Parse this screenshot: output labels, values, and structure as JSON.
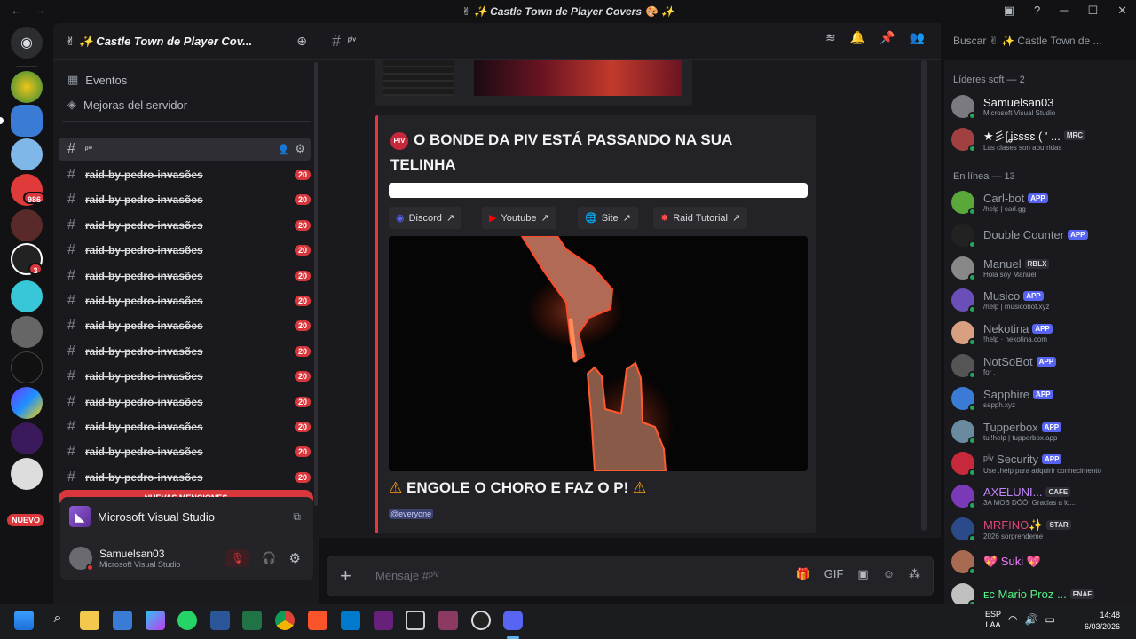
{
  "window": {
    "title": "✌ ✨ Castle Town de Player Covers 🎨 ✨"
  },
  "server": {
    "name": "✌ ✨ Castle Town de Player Cov...",
    "links": [
      {
        "label": "Eventos"
      },
      {
        "label": "Mejoras del servidor"
      }
    ],
    "active_channel": "ᵖⁱᵛ",
    "channels": [
      {
        "name": "raid-by-pedro-invasões",
        "badge": "20"
      },
      {
        "name": "raid-by-pedro-invasões",
        "badge": "20"
      },
      {
        "name": "raid-by-pedro-invasões",
        "badge": "20"
      },
      {
        "name": "raid-by-pedro-invasões",
        "badge": "20"
      },
      {
        "name": "raid-by-pedro-invasões",
        "badge": "20"
      },
      {
        "name": "raid-by-pedro-invasões",
        "badge": "20"
      },
      {
        "name": "raid-by-pedro-invasões",
        "badge": "20"
      },
      {
        "name": "raid-by-pedro-invasões",
        "badge": "20"
      },
      {
        "name": "raid-by-pedro-invasões",
        "badge": "20"
      },
      {
        "name": "raid-by-pedro-invasões",
        "badge": "20"
      },
      {
        "name": "raid-by-pedro-invasões",
        "badge": "20"
      },
      {
        "name": "raid-by-pedro-invasões",
        "badge": "20"
      },
      {
        "name": "raid-by-pedro-invasões",
        "badge": "20"
      }
    ],
    "new_mentions": "NUEVAS MENCIONES"
  },
  "rail": {
    "badges": [
      "986",
      "3"
    ],
    "nuevo": "NUEVO"
  },
  "activity": {
    "app": "Microsoft Visual Studio"
  },
  "user": {
    "name": "Samuelsan03",
    "status": "Microsoft Visual Studio"
  },
  "channel_header": {
    "name": "ᵖⁱᵛ",
    "search_placeholder": "Buscar ✌ ✨ Castle Town de ..."
  },
  "embed": {
    "title": "O BONDE DA PIV ESTÁ PASSANDO NA SUA TELINHA",
    "buttons": [
      {
        "label": "Discord"
      },
      {
        "label": "Youtube"
      },
      {
        "label": "Site"
      },
      {
        "label": "Raid Tutorial"
      }
    ],
    "footer_title": "ENGOLE O CHORO E FAZ O P!",
    "mention": "@everyone",
    "emoji": "PIV"
  },
  "composer": {
    "placeholder": "Mensaje #ᵖⁱᵛ"
  },
  "members": {
    "group1": "Líderes soft — 2",
    "group2": "En línea — 13",
    "leaders": [
      {
        "name": "Samuelsan03",
        "sub": "Microsoft Visual Studio",
        "color": "#f2f3f5"
      },
      {
        "name": "★彡[ʝɛѕѕɛ ( ' ...",
        "tag": "MRC",
        "sub": "Las clases son aburridas",
        "color": "#f2f3f5"
      }
    ],
    "online": [
      {
        "name": "Carl-bot",
        "tag": "APP",
        "sub": "/help | carl.gg",
        "color": "#949ba4"
      },
      {
        "name": "Double Counter",
        "tag": "APP",
        "sub": "",
        "color": "#949ba4"
      },
      {
        "name": "Manuel",
        "tag": "RBLX",
        "sub": "Hola soy Manuel",
        "color": "#949ba4"
      },
      {
        "name": "Musico",
        "tag": "APP",
        "sub": "/help | musicobot.xyz",
        "color": "#949ba4"
      },
      {
        "name": "Nekotina",
        "tag": "APP",
        "sub": "!help · nekotina.com",
        "color": "#949ba4"
      },
      {
        "name": "NotSoBot",
        "tag": "APP",
        "sub": "for .",
        "color": "#949ba4"
      },
      {
        "name": "Sapphire",
        "tag": "APP",
        "sub": "sapph.xyz",
        "color": "#949ba4"
      },
      {
        "name": "Tupperbox",
        "tag": "APP",
        "sub": "tul!help | tupperbox.app",
        "color": "#949ba4"
      },
      {
        "name": "ᵖⁱᵛ Security",
        "tag": "APP",
        "sub": "Use .help para adquirir conhecimento",
        "color": "#949ba4"
      },
      {
        "name": "AXELUNI...",
        "tag": "CAFE",
        "sub": "3A MOB DÖÖ: Gracias a lo...",
        "color": "#c084fc"
      },
      {
        "name": "MRFINO✨",
        "tag": "STAR",
        "sub": "2026 sorprendeme",
        "color": "#e0457b"
      },
      {
        "name": "💖 Suki 💖",
        "tag": "",
        "sub": "",
        "color": "#f47fff"
      },
      {
        "name": "ᴇᴄ Mario Proz ...",
        "tag": "FNAF",
        "sub": "",
        "color": "#57f287"
      }
    ]
  },
  "taskbar": {
    "lang1": "ESP",
    "lang2": "LAA",
    "time": "14:48",
    "date": "6/03/2026"
  },
  "colors": {
    "accent": "#5865f2",
    "danger": "#da373c",
    "online": "#23a55a"
  }
}
